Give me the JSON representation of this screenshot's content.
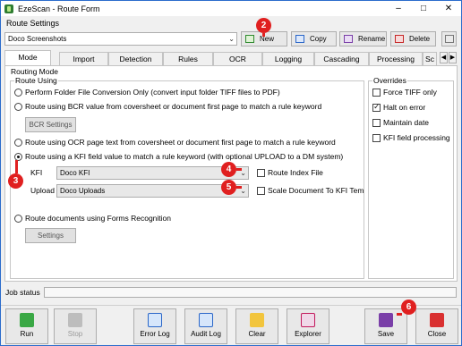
{
  "window": {
    "title": "EzeScan - Route Form",
    "controls": [
      "–",
      "□",
      "✕"
    ]
  },
  "route_settings": {
    "label": "Route Settings",
    "selected": "Doco Screenshots",
    "buttons": {
      "new": "New",
      "copy": "Copy",
      "rename": "Rename",
      "delete": "Delete"
    }
  },
  "tabs": [
    {
      "label": "Mode",
      "active": true
    },
    {
      "label": "Import"
    },
    {
      "label": "Detection"
    },
    {
      "label": "Rules"
    },
    {
      "label": "OCR"
    },
    {
      "label": "Logging"
    },
    {
      "label": "Cascading"
    },
    {
      "label": "Processing"
    },
    {
      "label": "Sc"
    }
  ],
  "mode": {
    "routing_mode": "Routing Mode",
    "route_using": "Route Using",
    "options": {
      "folder": "Perform Folder File Conversion Only (convert input folder TIFF files to PDF)",
      "bcr": "Route using BCR value from coversheet or document first page to match a rule keyword",
      "ocr": "Route using OCR page text from coversheet or document first page to match a rule keyword",
      "kfi": "Route using a KFI field value to match a rule keyword (with optional UPLOAD to a DM system)",
      "forms": "Route documents using Forms Recognition"
    },
    "bcr_settings": "BCR Settings",
    "kfi_label": "KFI",
    "kfi_value": "Doco KFI",
    "upload_label": "Upload",
    "upload_value": "Doco Uploads",
    "route_index_file": "Route Index File",
    "scale_document": "Scale Document To KFI Tem",
    "forms_settings": "Settings",
    "overrides": {
      "title": "Overrides",
      "force_tiff": "Force TIFF only",
      "halt_on_error": "Halt on error",
      "maintain_date": "Maintain date",
      "kfi_field_processing": "KFI field processing"
    }
  },
  "status": {
    "label": "Job status"
  },
  "toolbar": {
    "run": "Run",
    "stop": "Stop",
    "error_log": "Error Log",
    "audit_log": "Audit Log",
    "clear": "Clear",
    "explorer": "Explorer",
    "save": "Save",
    "close": "Close"
  },
  "callouts": {
    "c2": "2",
    "c3": "3",
    "c4": "4",
    "c5": "5",
    "c6": "6"
  },
  "colors": {
    "callout": "#e02020",
    "window_border": "#2b6ccc",
    "run_green": "#3aa845",
    "close_red": "#d93030"
  }
}
